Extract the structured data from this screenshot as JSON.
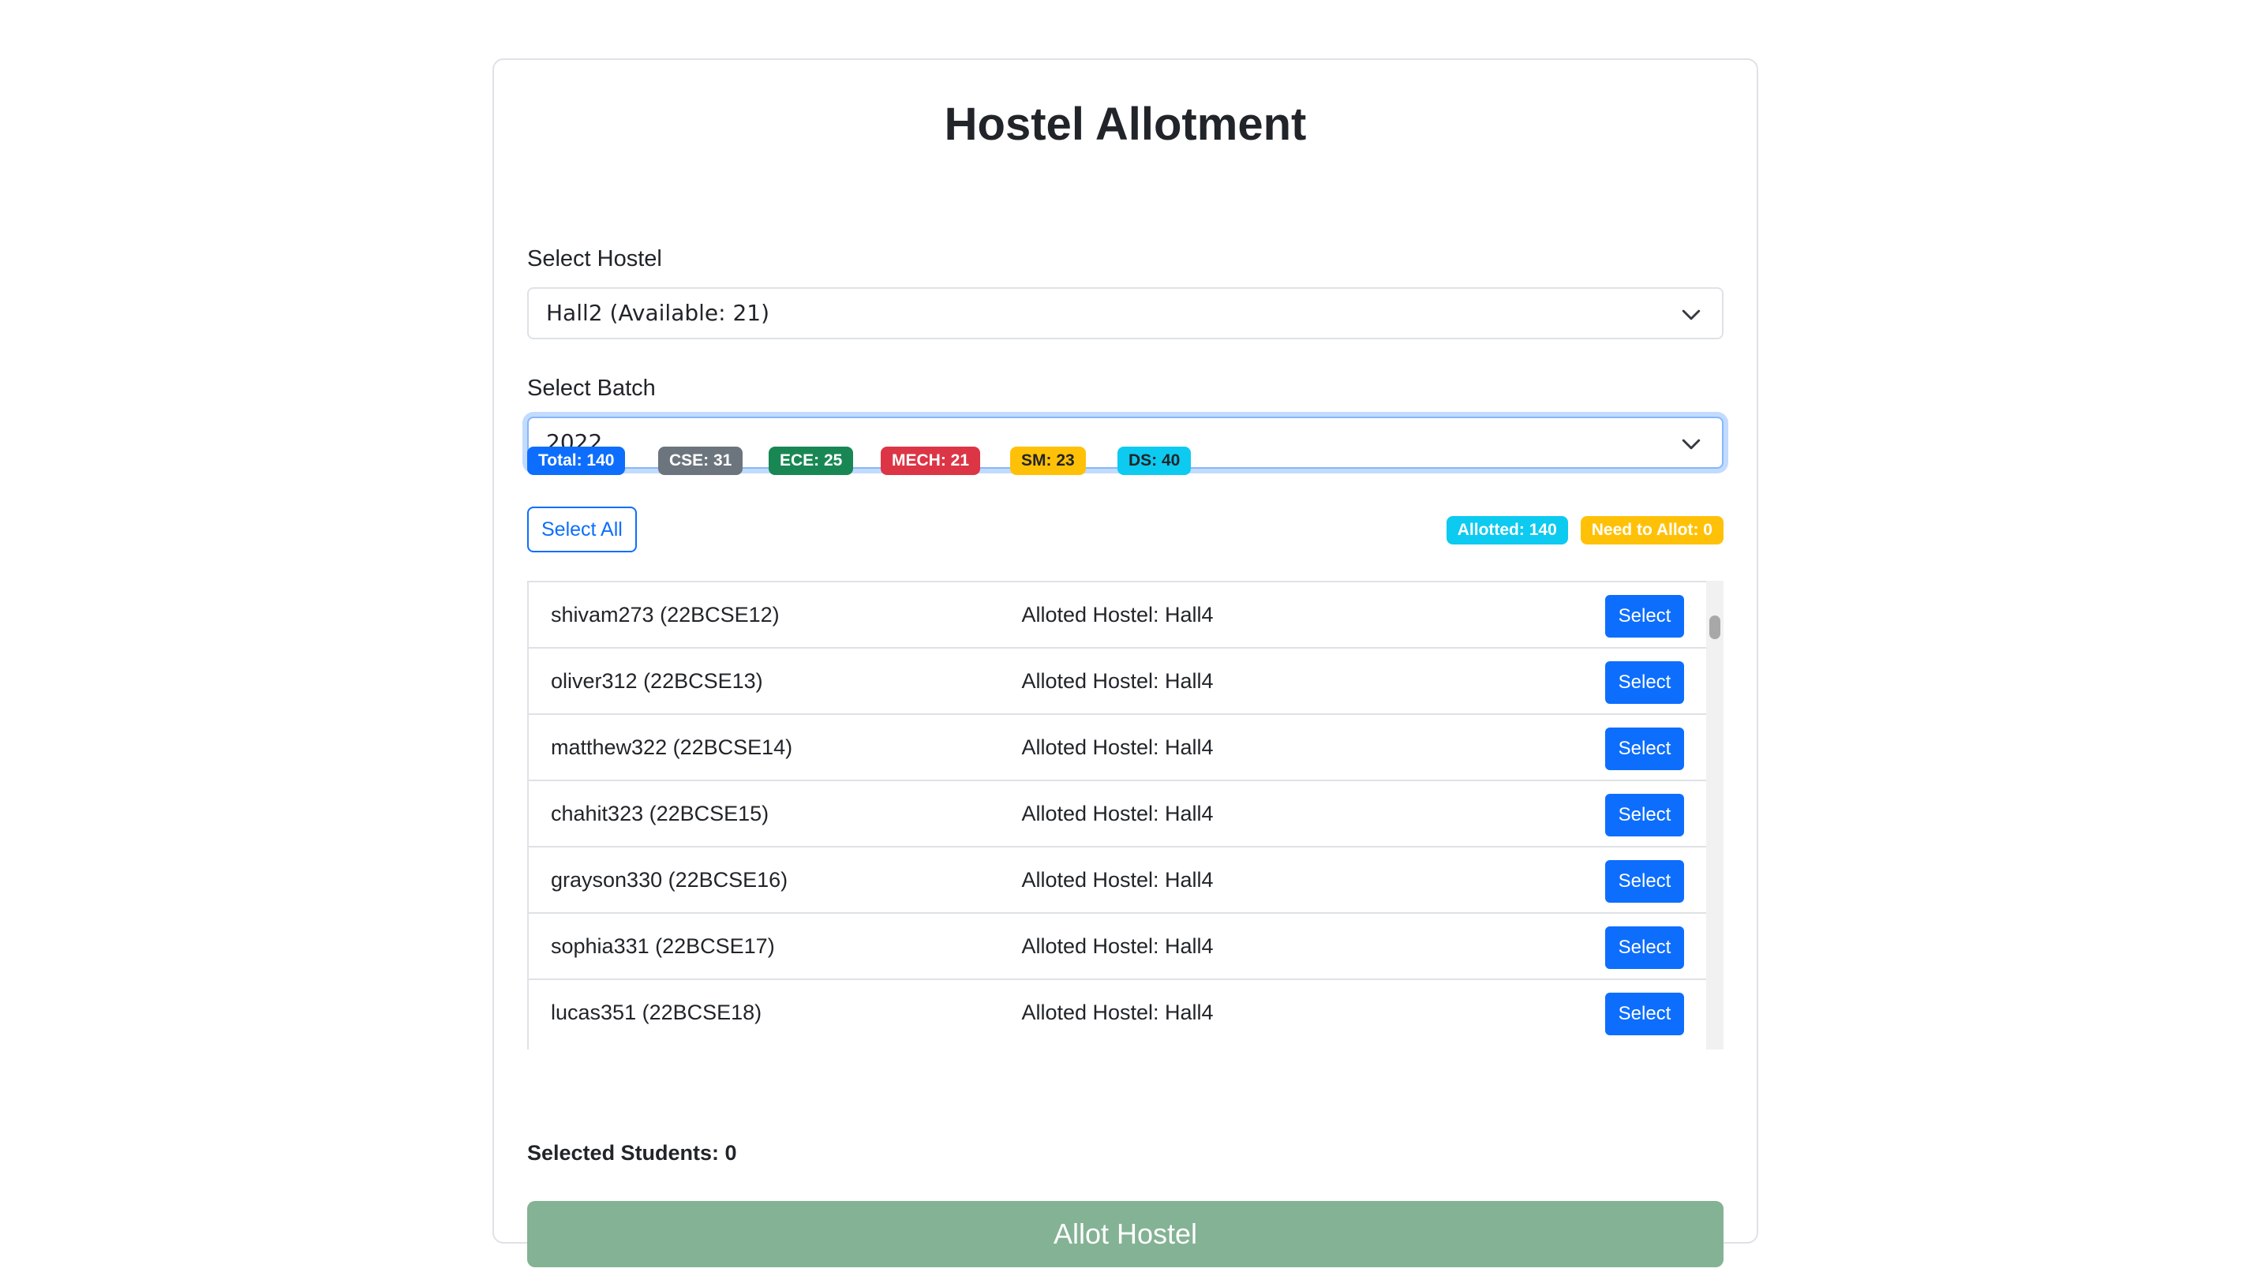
{
  "page": {
    "title": "Hostel Allotment"
  },
  "hostel": {
    "label": "Select Hostel",
    "selected": "Hall2 (Available: 21)"
  },
  "batch": {
    "label": "Select Batch",
    "selected": "2022"
  },
  "stats": {
    "total": "Total: 140",
    "cse": "CSE: 31",
    "ece": "ECE: 25",
    "mech": "MECH: 21",
    "sm": "SM: 23",
    "ds": "DS: 40"
  },
  "actions": {
    "select_all": "Select All",
    "allotted": "Allotted: 140",
    "need_to_allot": "Need to Allot: 0"
  },
  "students": [
    {
      "name": "shivam273 (22BCSE12)",
      "hostel": "Alloted Hostel: Hall4",
      "button": "Select"
    },
    {
      "name": "oliver312 (22BCSE13)",
      "hostel": "Alloted Hostel: Hall4",
      "button": "Select"
    },
    {
      "name": "matthew322 (22BCSE14)",
      "hostel": "Alloted Hostel: Hall4",
      "button": "Select"
    },
    {
      "name": "chahit323 (22BCSE15)",
      "hostel": "Alloted Hostel: Hall4",
      "button": "Select"
    },
    {
      "name": "grayson330 (22BCSE16)",
      "hostel": "Alloted Hostel: Hall4",
      "button": "Select"
    },
    {
      "name": "sophia331 (22BCSE17)",
      "hostel": "Alloted Hostel: Hall4",
      "button": "Select"
    },
    {
      "name": "lucas351 (22BCSE18)",
      "hostel": "Alloted Hostel: Hall4",
      "button": "Select"
    }
  ],
  "footer": {
    "selected_students": "Selected Students: 0",
    "allot_button": "Allot Hostel"
  },
  "colors": {
    "primary": "#0d6efd",
    "secondary": "#6c757d",
    "success": "#198754",
    "danger": "#dc3545",
    "warning": "#ffc107",
    "info": "#0dcaf0",
    "allot_button_disabled": "#84b294"
  }
}
